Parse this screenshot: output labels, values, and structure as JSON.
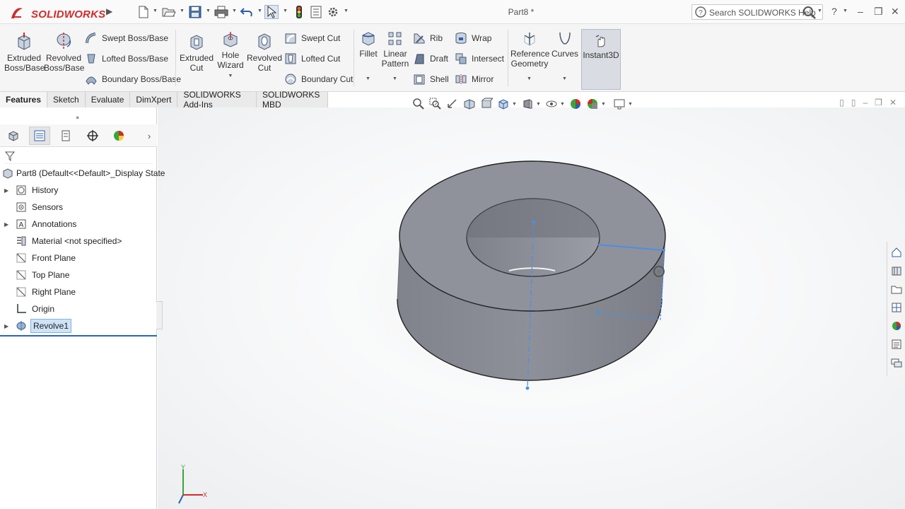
{
  "app": {
    "brand": "SOLIDWORKS",
    "document_title": "Part8 *"
  },
  "search": {
    "placeholder": "Search SOLIDWORKS Help"
  },
  "window_controls": {
    "help": "?",
    "minimize": "–",
    "restore": "❐",
    "close": "✕"
  },
  "ribbon": {
    "extrude": [
      "Extruded",
      "Boss/Base"
    ],
    "revolve": [
      "Revolved",
      "Boss/Base"
    ],
    "swept_boss": "Swept Boss/Base",
    "lofted_boss": "Lofted Boss/Base",
    "boundary_boss": "Boundary Boss/Base",
    "extruded_cut": [
      "Extruded",
      "Cut"
    ],
    "hole_wizard": [
      "Hole",
      "Wizard"
    ],
    "revolved_cut": [
      "Revolved",
      "Cut"
    ],
    "swept_cut": "Swept Cut",
    "lofted_cut": "Lofted Cut",
    "boundary_cut": "Boundary Cut",
    "fillet": "Fillet",
    "linear_pattern": [
      "Linear",
      "Pattern"
    ],
    "rib": "Rib",
    "draft": "Draft",
    "shell": "Shell",
    "wrap": "Wrap",
    "intersect": "Intersect",
    "mirror": "Mirror",
    "reference_geometry": [
      "Reference",
      "Geometry"
    ],
    "curves": "Curves",
    "instant3d": "Instant3D"
  },
  "tabs": [
    {
      "label": "Features",
      "active": true
    },
    {
      "label": "Sketch",
      "active": false
    },
    {
      "label": "Evaluate",
      "active": false
    },
    {
      "label": "DimXpert",
      "active": false
    },
    {
      "label": "SOLIDWORKS Add-Ins",
      "active": false
    },
    {
      "label": "SOLIDWORKS MBD",
      "active": false
    }
  ],
  "feature_tree": {
    "root": "Part8  (Default<<Default>_Display State",
    "items": [
      {
        "label": "History",
        "expandable": true,
        "icon": "history-icon"
      },
      {
        "label": "Sensors",
        "expandable": false,
        "icon": "sensors-icon"
      },
      {
        "label": "Annotations",
        "expandable": true,
        "icon": "annotations-icon"
      },
      {
        "label": "Material <not specified>",
        "expandable": false,
        "icon": "material-icon"
      },
      {
        "label": "Front Plane",
        "expandable": false,
        "icon": "plane-icon"
      },
      {
        "label": "Top Plane",
        "expandable": false,
        "icon": "plane-icon"
      },
      {
        "label": "Right Plane",
        "expandable": false,
        "icon": "plane-icon"
      },
      {
        "label": "Origin",
        "expandable": false,
        "icon": "origin-icon"
      },
      {
        "label": "Revolve1",
        "expandable": true,
        "icon": "revolve-icon",
        "selected": true
      }
    ]
  },
  "colors": {
    "brand_red": "#d42a2a",
    "selection_blue": "#4a90e2",
    "part_gray": "#8f929b"
  },
  "triad": {
    "x": "X",
    "y": "Y"
  }
}
